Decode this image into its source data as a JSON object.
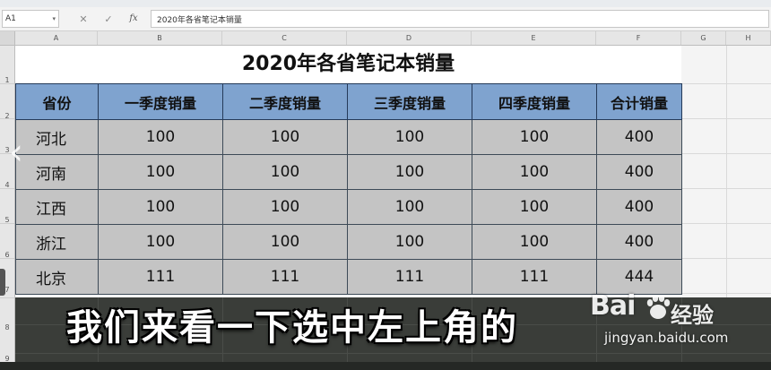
{
  "formula_bar": {
    "cell_ref": "A1",
    "formula": "2020年各省笔记本销量",
    "icons": [
      "cancel-icon",
      "confirm-icon",
      "function-icon"
    ]
  },
  "column_headers": [
    "A",
    "B",
    "C",
    "D",
    "E",
    "F",
    "G",
    "H"
  ],
  "row_numbers": [
    "1",
    "2",
    "3",
    "4",
    "5",
    "6",
    "7",
    "8",
    "9"
  ],
  "sheet": {
    "title": "2020年各省笔记本销量",
    "headers": [
      "省份",
      "一季度销量",
      "二季度销量",
      "三季度销量",
      "四季度销量",
      "合计销量"
    ],
    "rows": [
      {
        "province": "河北",
        "q1": "100",
        "q2": "100",
        "q3": "100",
        "q4": "100",
        "total": "400"
      },
      {
        "province": "河南",
        "q1": "100",
        "q2": "100",
        "q3": "100",
        "q4": "100",
        "total": "400"
      },
      {
        "province": "江西",
        "q1": "100",
        "q2": "100",
        "q3": "100",
        "q4": "100",
        "total": "400"
      },
      {
        "province": "浙江",
        "q1": "100",
        "q2": "100",
        "q3": "100",
        "q4": "100",
        "total": "400"
      },
      {
        "province": "北京",
        "q1": "111",
        "q2": "111",
        "q3": "111",
        "q4": "111",
        "total": "444"
      }
    ]
  },
  "overlay": {
    "subtitle": "我们来看一下选中左上角的",
    "watermark_brand": "Bai",
    "watermark_sub": "经验",
    "watermark_url": "jingyan.baidu.com"
  },
  "colors": {
    "header_fill": "#7fa3cf",
    "cell_fill": "#c4c4c4",
    "sheet_bg": "#ffffff"
  }
}
